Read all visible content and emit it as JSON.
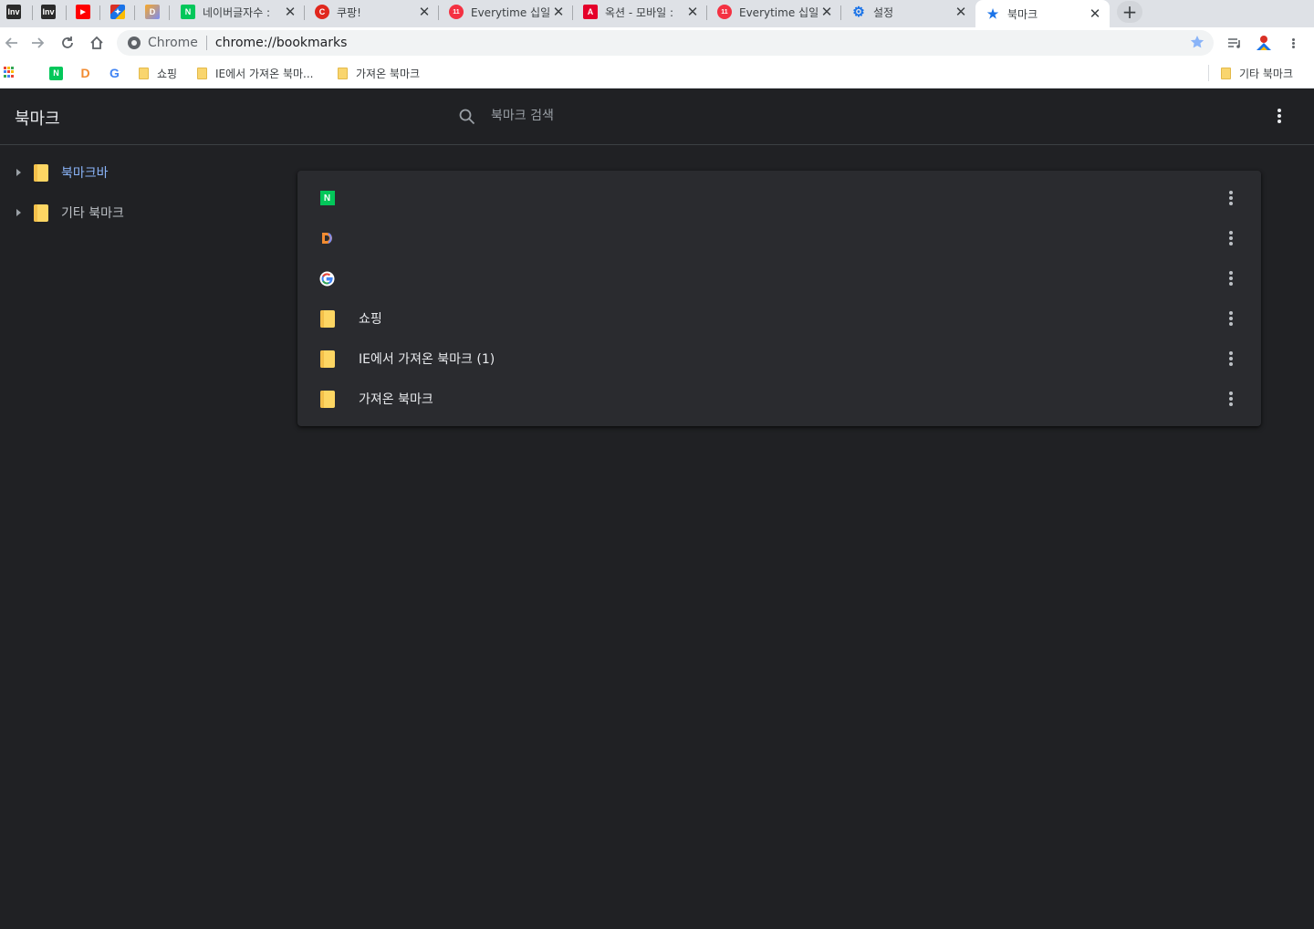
{
  "tabs": [
    {
      "title": "",
      "icon": "inven-icon",
      "fav": "Inv",
      "color": "#2b2b2b"
    },
    {
      "title": "",
      "icon": "inven-icon",
      "fav": "Inv",
      "color": "#2b2b2b"
    },
    {
      "title": "",
      "icon": "youtube-icon",
      "fav": "▶",
      "color": "#ff0000"
    },
    {
      "title": "",
      "icon": "colorful-logo-icon",
      "fav": "✦",
      "color": "#d93025"
    },
    {
      "title": "",
      "icon": "daum-icon",
      "fav": "D",
      "color": "#7b8cf5"
    },
    {
      "title": "네이버글자수 :",
      "icon": "naver-icon",
      "fav": "N",
      "color": "#03c75a",
      "close": "✕"
    },
    {
      "title": "쿠팡!",
      "icon": "coupang-icon",
      "fav": "C",
      "color": "#e0271d",
      "close": "✕"
    },
    {
      "title": "Everytime 십일",
      "icon": "11st-icon",
      "fav": "11",
      "color": "#f43142",
      "close": "✕"
    },
    {
      "title": "옥션 - 모바일 :",
      "icon": "auction-icon",
      "fav": "A",
      "color": "#e5002a",
      "close": "✕"
    },
    {
      "title": "Everytime 십일",
      "icon": "11st-icon",
      "fav": "11",
      "color": "#f43142",
      "close": "✕"
    },
    {
      "title": "설정",
      "icon": "settings-gear-icon",
      "fav": "⚙",
      "color": "#1a73e8",
      "close": "✕"
    },
    {
      "title": "북마크",
      "icon": "star-icon",
      "fav": "★",
      "color": "#1a73e8",
      "close": "✕"
    }
  ],
  "newtab": "+",
  "omnibox": {
    "label": "Chrome",
    "url": "chrome://bookmarks"
  },
  "bookmarks_bar": {
    "items": [
      {
        "label": "",
        "type": "naver",
        "fav": "N"
      },
      {
        "label": "",
        "type": "daum",
        "fav": "D"
      },
      {
        "label": "",
        "type": "google",
        "fav": "G"
      },
      {
        "label": "쇼핑",
        "type": "folder"
      },
      {
        "label": "IE에서 가져온 북마...",
        "type": "folder"
      },
      {
        "label": "가져온 북마크",
        "type": "folder"
      }
    ],
    "other": "기타 북마크"
  },
  "page": {
    "title": "북마크",
    "search_placeholder": "북마크 검색"
  },
  "sidebar": {
    "items": [
      {
        "label": "북마크바",
        "selected": true
      },
      {
        "label": "기타 북마크",
        "selected": false
      }
    ]
  },
  "list": {
    "items": [
      {
        "title": "",
        "icon": "naver-favicon"
      },
      {
        "title": "",
        "icon": "daum-favicon"
      },
      {
        "title": "",
        "icon": "google-favicon"
      },
      {
        "title": "쇼핑",
        "icon": "folder-icon"
      },
      {
        "title": "IE에서 가져온 북마크 (1)",
        "icon": "folder-icon"
      },
      {
        "title": "가져온 북마크",
        "icon": "folder-icon"
      }
    ]
  },
  "colors": {
    "background": "#202124",
    "accent": "#8ab4f8",
    "card": "#2a2b2f",
    "folder": "#fdd663"
  }
}
